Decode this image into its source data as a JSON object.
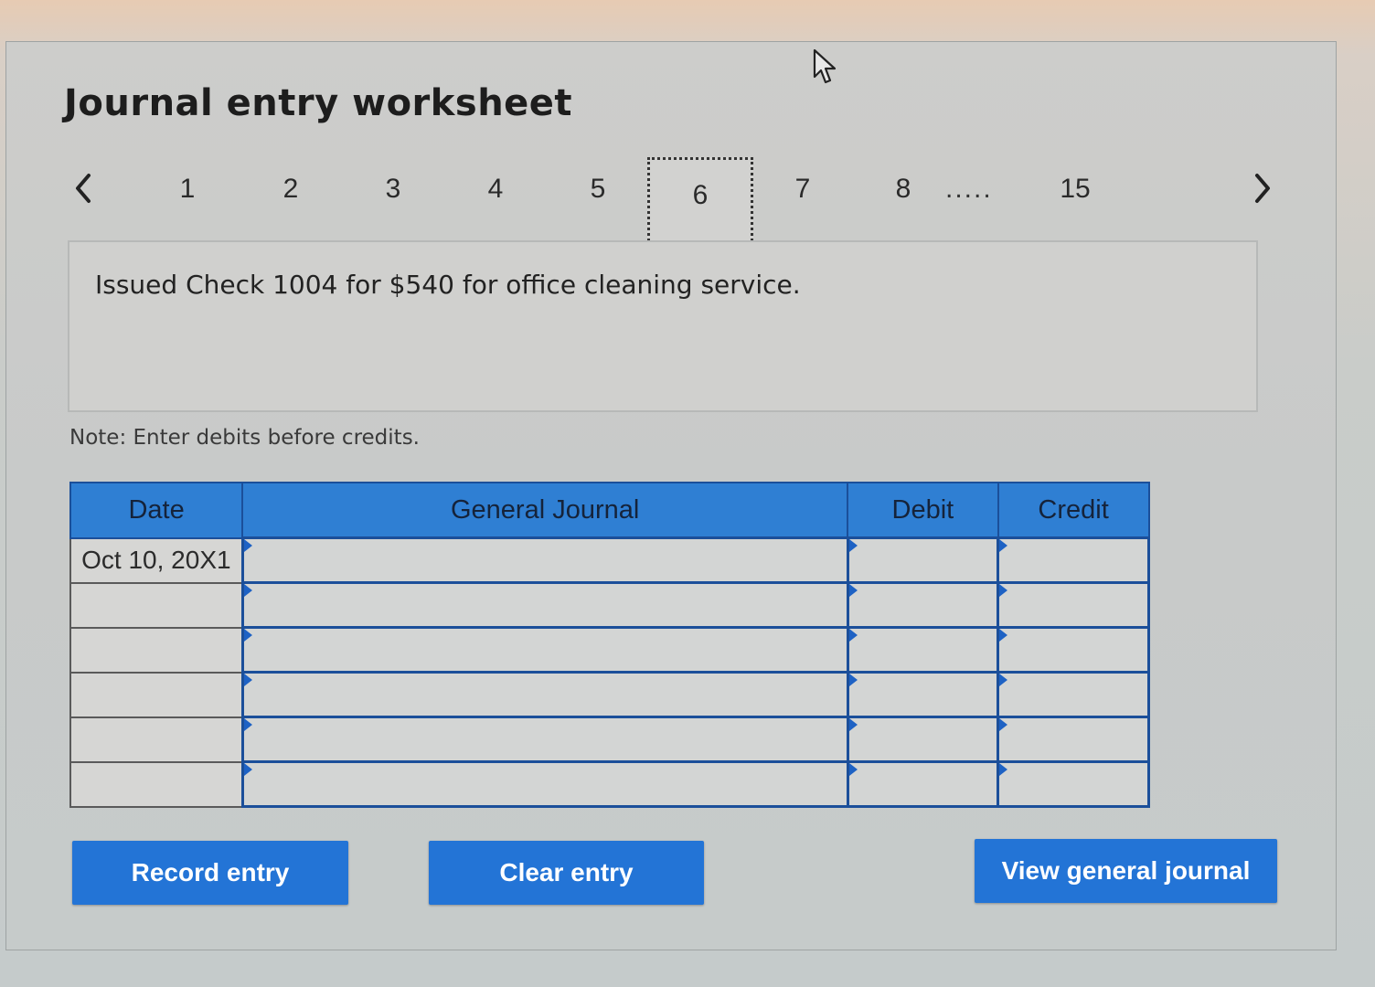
{
  "title": "Journal entry worksheet",
  "pagination": {
    "pages": [
      "1",
      "2",
      "3",
      "4",
      "5",
      "6",
      "7",
      "8"
    ],
    "active": "6",
    "ellipsis": ".....",
    "last": "15"
  },
  "description": "Issued Check 1004 for $540 for office cleaning service.",
  "note": "Note: Enter debits before credits.",
  "table": {
    "headers": {
      "date": "Date",
      "journal": "General Journal",
      "debit": "Debit",
      "credit": "Credit"
    },
    "rows": [
      {
        "date": "Oct 10, 20X1",
        "account": "",
        "debit": "",
        "credit": ""
      },
      {
        "date": "",
        "account": "",
        "debit": "",
        "credit": ""
      },
      {
        "date": "",
        "account": "",
        "debit": "",
        "credit": ""
      },
      {
        "date": "",
        "account": "",
        "debit": "",
        "credit": ""
      },
      {
        "date": "",
        "account": "",
        "debit": "",
        "credit": ""
      },
      {
        "date": "",
        "account": "",
        "debit": "",
        "credit": ""
      }
    ]
  },
  "buttons": {
    "record": "Record entry",
    "clear": "Clear entry",
    "view": "View general journal"
  },
  "icons": {
    "prev": "chevron-left-icon",
    "next": "chevron-right-icon",
    "cursor": "mouse-pointer-icon"
  },
  "colors": {
    "accent": "#2374d6",
    "header_bg": "#2f7fd3",
    "grid_border": "#1b4f9a"
  }
}
